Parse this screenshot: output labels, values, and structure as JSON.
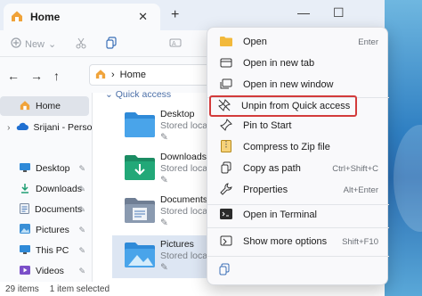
{
  "window": {
    "tab_title": "Home",
    "tab_icon": "home-icon",
    "close_tab": "✕",
    "new_tab": "+",
    "minimize": "—",
    "maximize": "☐"
  },
  "toolbar": {
    "new_label": "New",
    "new_chevron": "⌄"
  },
  "address": {
    "back": "←",
    "forward": "→",
    "up": "↑",
    "location": "Home",
    "chevron": "›"
  },
  "sidebar": {
    "home": "Home",
    "onedrive": "Srijani - Persona",
    "items": [
      {
        "label": "Desktop",
        "icon": "desktop-icon"
      },
      {
        "label": "Downloads",
        "icon": "downloads-icon"
      },
      {
        "label": "Documents",
        "icon": "documents-icon"
      },
      {
        "label": "Pictures",
        "icon": "pictures-icon"
      },
      {
        "label": "This PC",
        "icon": "pc-icon"
      },
      {
        "label": "Videos",
        "icon": "videos-icon"
      }
    ]
  },
  "main": {
    "section_header": "Quick access",
    "files": [
      {
        "name": "Desktop",
        "sub": "Stored locally"
      },
      {
        "name": "Downloads",
        "sub": "Stored locally"
      },
      {
        "name": "Documents",
        "sub": "Stored locally"
      },
      {
        "name": "Pictures",
        "sub": "Stored locally"
      }
    ]
  },
  "status": {
    "count": "29 items",
    "selected": "1 item selected"
  },
  "context_menu": {
    "items": [
      {
        "label": "Open",
        "shortcut": "Enter",
        "icon": "folder-icon"
      },
      {
        "label": "Open in new tab",
        "shortcut": "",
        "icon": "new-tab-icon"
      },
      {
        "label": "Open in new window",
        "shortcut": "",
        "icon": "new-window-icon"
      },
      {
        "label": "Unpin from Quick access",
        "shortcut": "",
        "icon": "unpin-icon"
      },
      {
        "label": "Pin to Start",
        "shortcut": "",
        "icon": "pin-icon"
      },
      {
        "label": "Compress to Zip file",
        "shortcut": "",
        "icon": "zip-icon"
      },
      {
        "label": "Copy as path",
        "shortcut": "Ctrl+Shift+C",
        "icon": "copy-path-icon"
      },
      {
        "label": "Properties",
        "shortcut": "Alt+Enter",
        "icon": "properties-icon"
      },
      {
        "label": "Open in Terminal",
        "shortcut": "",
        "icon": "terminal-icon"
      },
      {
        "label": "Show more options",
        "shortcut": "Shift+F10",
        "icon": "more-options-icon"
      }
    ]
  },
  "colors": {
    "highlight_border": "#d33b3b",
    "folder_blue": "#3a8fd6",
    "accent": "#4b6fa8"
  }
}
